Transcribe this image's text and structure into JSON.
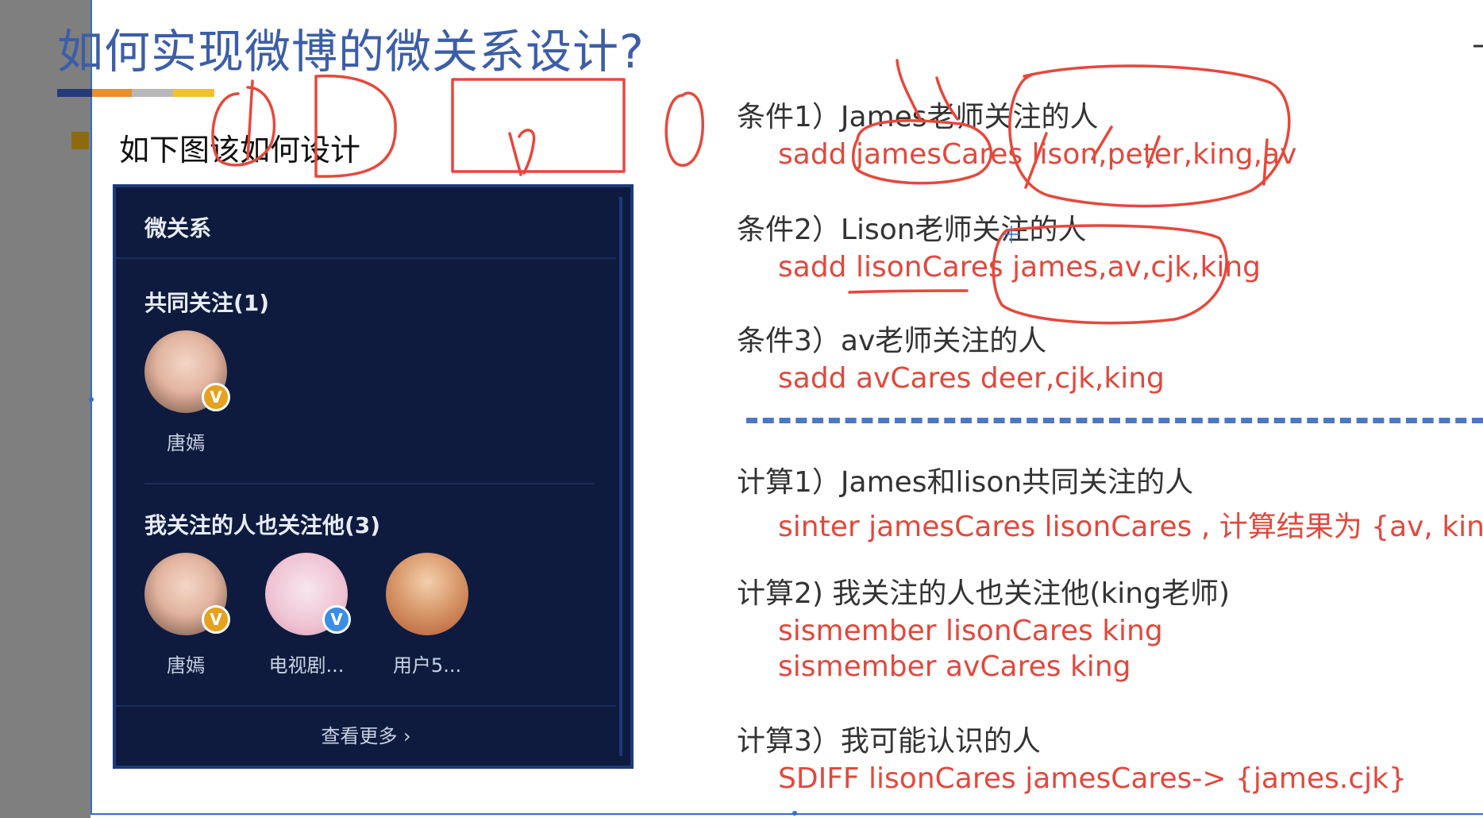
{
  "title": "如何实现微博的微关系设计?",
  "subtitle": "如下图该如何设计",
  "panel": {
    "title": "微关系",
    "common_title": "共同关注(1)",
    "common_users": [
      {
        "name": "唐嫣",
        "badge": "V",
        "badge_color": "#e6a11f"
      }
    ],
    "also_title": "我关注的人也关注他(3)",
    "also_users": [
      {
        "name": "唐嫣",
        "badge": "V",
        "badge_color": "#e6a11f"
      },
      {
        "name": "电视剧...",
        "badge": "V",
        "badge_color": "#3a8ee6"
      },
      {
        "name": "用户5...",
        "badge": "",
        "badge_color": ""
      }
    ],
    "more": "查看更多 ›"
  },
  "conditions": [
    {
      "label": "条件1）James老师关注的人",
      "cmd": "sadd jamesCares lison,peter,king,av"
    },
    {
      "label": "条件2）Lison老师关注的人",
      "cmd": "sadd lisonCares james,av,cjk,king"
    },
    {
      "label": "条件3）av老师关注的人",
      "cmd": "sadd avCares deer,cjk,king"
    }
  ],
  "calcs": [
    {
      "label": "计算1）James和lison共同关注的人",
      "cmds": [
        "sinter jamesCares lisonCares , 计算结果为 {av, king}"
      ]
    },
    {
      "label": "计算2) 我关注的人也关注他(king老师)",
      "cmds": [
        "sismember lisonCares king",
        "sismember avCares king"
      ]
    },
    {
      "label": "计算3）我可能认识的人",
      "cmds": [
        "SDIFF lisonCares jamesCares-> {james.cjk}"
      ]
    }
  ],
  "colors": {
    "title": "#3c5ea8",
    "command": "#e2483d",
    "panel_bg": "#0e1b3f",
    "annotation": "#e8473b",
    "divider": "#4c77c4",
    "bar": [
      "#243c7a",
      "#e8902c",
      "#b8b8b8",
      "#f2c12e"
    ]
  }
}
